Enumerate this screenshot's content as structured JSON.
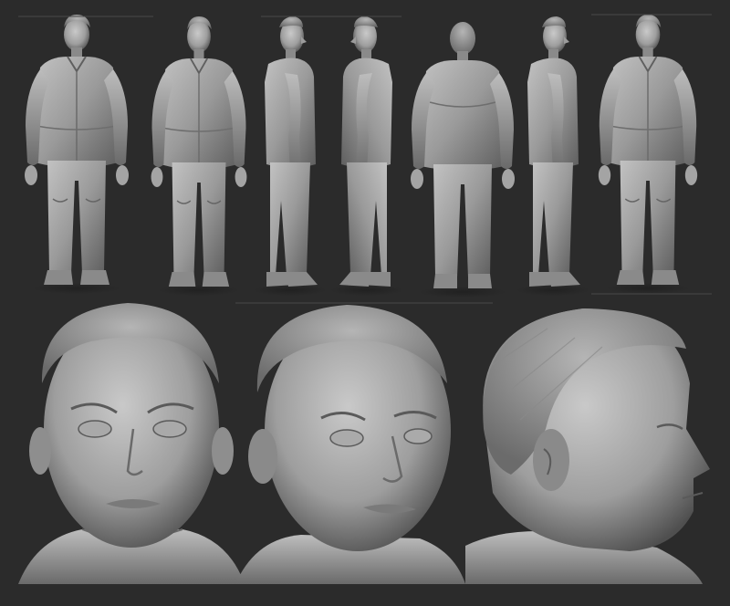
{
  "scene": {
    "description_colors": {
      "background": "#2b2b2b",
      "clay_light": "#b8b8b8",
      "clay_mid": "#8e8e8e",
      "clay_dark": "#5a5a5a",
      "clay_shadow": "#3c3c3c"
    },
    "full_body_views": [
      "front",
      "three-quarter-left",
      "side-left",
      "side-left-alt",
      "back",
      "side-right",
      "three-quarter-right"
    ],
    "head_views": [
      "front",
      "three-quarter",
      "profile-right"
    ]
  }
}
